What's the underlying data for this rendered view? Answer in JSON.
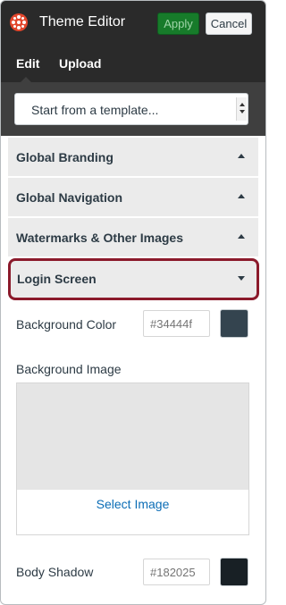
{
  "header": {
    "title": "Theme Editor",
    "apply_label": "Apply",
    "cancel_label": "Cancel",
    "colors": {
      "bar": "#2a2a2a",
      "apply": "#177b2a",
      "logo": "#e2462c"
    }
  },
  "tabs": [
    {
      "label": "Edit",
      "active": true
    },
    {
      "label": "Upload",
      "active": false
    }
  ],
  "template_select": {
    "value": "Start from a template..."
  },
  "sections": [
    {
      "label": "Global Branding",
      "expanded": false,
      "caret": "caret-up-icon"
    },
    {
      "label": "Global Navigation",
      "expanded": false,
      "caret": "caret-up-icon"
    },
    {
      "label": "Watermarks & Other Images",
      "expanded": false,
      "caret": "caret-up-icon"
    },
    {
      "label": "Login Screen",
      "expanded": true,
      "caret": "caret-down-icon",
      "highlight": "#8b1a2b"
    }
  ],
  "login_screen": {
    "background_color": {
      "label": "Background Color",
      "placeholder": "#34444f",
      "swatch": "#34444f"
    },
    "background_image": {
      "label": "Background Image",
      "action": "Select Image"
    },
    "body_shadow": {
      "label": "Body Shadow",
      "placeholder": "#182025",
      "swatch": "#182025"
    }
  }
}
